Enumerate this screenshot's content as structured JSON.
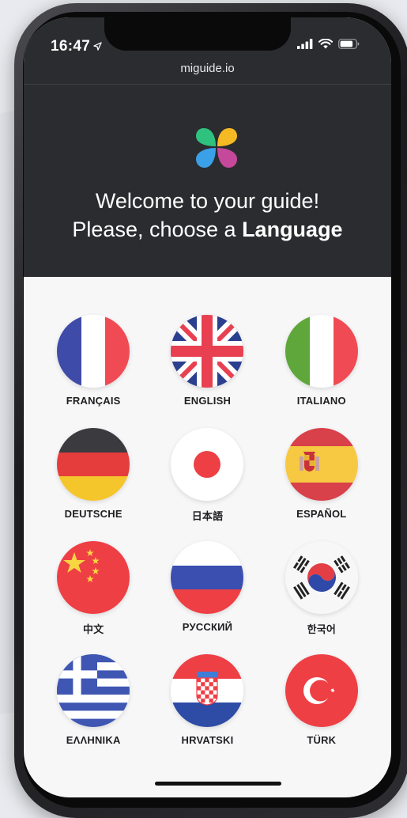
{
  "status_bar": {
    "time": "16:47",
    "location_icon": "location-arrow-icon",
    "signal_icon": "signal-icon",
    "wifi_icon": "wifi-icon",
    "battery_icon": "battery-icon"
  },
  "browser": {
    "url": "miguide.io"
  },
  "header": {
    "logo_icon": "four-petal-logo-icon",
    "welcome_line": "Welcome to your guide!",
    "choose_prefix": "Please, choose a ",
    "choose_emphasis": "Language"
  },
  "languages": [
    {
      "label": "FRANÇAIS",
      "flag": "france-flag-icon"
    },
    {
      "label": "ENGLISH",
      "flag": "uk-flag-icon"
    },
    {
      "label": "ITALIANO",
      "flag": "italy-flag-icon"
    },
    {
      "label": "DEUTSCHE",
      "flag": "germany-flag-icon"
    },
    {
      "label": "日本語",
      "flag": "japan-flag-icon"
    },
    {
      "label": "ESPAÑOL",
      "flag": "spain-flag-icon"
    },
    {
      "label": "中文",
      "flag": "china-flag-icon"
    },
    {
      "label": "РУССКИЙ",
      "flag": "russia-flag-icon"
    },
    {
      "label": "한국어",
      "flag": "korea-flag-icon"
    },
    {
      "label": "ΕΛΛΗΝΙΚΑ",
      "flag": "greece-flag-icon"
    },
    {
      "label": "HRVATSKI",
      "flag": "croatia-flag-icon"
    },
    {
      "label": "TÜRK",
      "flag": "turkey-flag-icon"
    }
  ],
  "colors": {
    "header_bg": "#2b2c2f",
    "content_bg": "#f7f7f8"
  }
}
